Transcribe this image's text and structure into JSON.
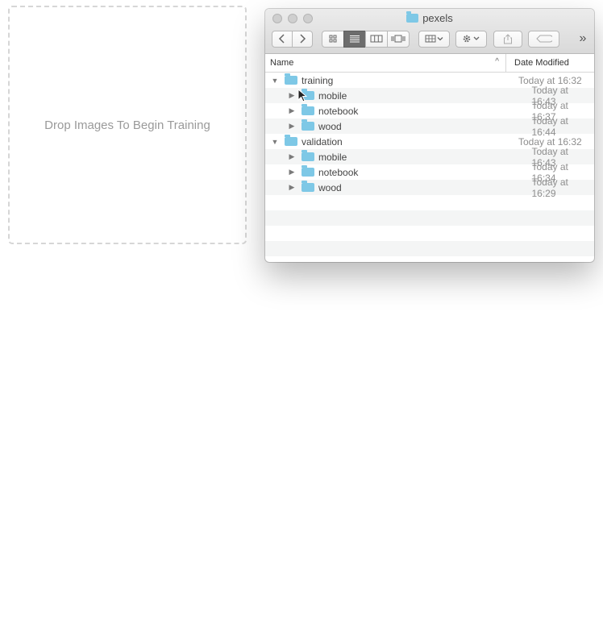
{
  "dropzone": {
    "text": "Drop Images To Begin Training"
  },
  "window": {
    "title": "pexels"
  },
  "toolbar": {
    "back_icon": "chevron-left-icon",
    "forward_icon": "chevron-right-icon",
    "view_icons": [
      "icon-view",
      "list-view",
      "column-view",
      "cover-flow-view"
    ],
    "group_icon": "group-icon",
    "action_icon": "gear-icon",
    "share_icon": "share-icon",
    "tags_icon": "tag-icon",
    "overflow_label": "»"
  },
  "columns": {
    "name": "Name",
    "date": "Date Modified"
  },
  "rows": [
    {
      "name": "training",
      "date": "Today at 16:32",
      "level": 0,
      "expanded": true
    },
    {
      "name": "mobile",
      "date": "Today at 16:43",
      "level": 1,
      "expanded": false
    },
    {
      "name": "notebook",
      "date": "Today at 16:37",
      "level": 1,
      "expanded": false
    },
    {
      "name": "wood",
      "date": "Today at 16:44",
      "level": 1,
      "expanded": false
    },
    {
      "name": "validation",
      "date": "Today at 16:32",
      "level": 0,
      "expanded": true
    },
    {
      "name": "mobile",
      "date": "Today at 16:43",
      "level": 1,
      "expanded": false
    },
    {
      "name": "notebook",
      "date": "Today at 16:34",
      "level": 1,
      "expanded": false
    },
    {
      "name": "wood",
      "date": "Today at 16:29",
      "level": 1,
      "expanded": false
    }
  ],
  "colors": {
    "folder": "#7ec8e6",
    "accent_active": "#6d6d6d"
  }
}
